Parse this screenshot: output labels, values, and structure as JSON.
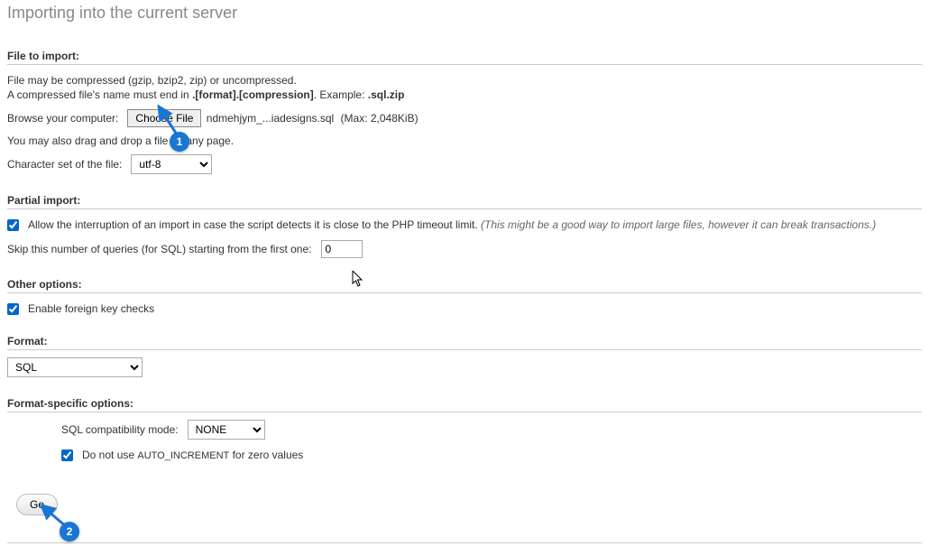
{
  "page_title": "Importing into the current server",
  "file_import": {
    "heading": "File to import:",
    "compress_note_1": "File may be compressed (gzip, bzip2, zip) or uncompressed.",
    "compress_note_2a": "A compressed file's name must end in ",
    "compress_note_2b": ".[format].[compression]",
    "compress_note_2c": ". Example: ",
    "compress_note_2d": ".sql.zip",
    "browse_label": "Browse your computer:",
    "choose_button": "Choose File",
    "selected_file": "ndmehjym_...iadesigns.sql",
    "max_size": "(Max: 2,048KiB)",
    "drag_note": "You may also drag and drop a file on any page.",
    "charset_label": "Character set of the file:",
    "charset_value": "utf-8"
  },
  "partial_import": {
    "heading": "Partial import:",
    "interrupt_label": "Allow the interruption of an import in case the script detects it is close to the PHP timeout limit.",
    "interrupt_note": "(This might be a good way to import large files, however it can break transactions.)",
    "skip_label": "Skip this number of queries (for SQL) starting from the first one:",
    "skip_value": "0"
  },
  "other_options": {
    "heading": "Other options:",
    "fk_label": "Enable foreign key checks"
  },
  "format": {
    "heading": "Format:",
    "value": "SQL"
  },
  "format_specific": {
    "heading": "Format-specific options:",
    "compat_label": "SQL compatibility mode:",
    "compat_value": "NONE",
    "noauto_prefix": "Do not use ",
    "noauto_code": "AUTO_INCREMENT",
    "noauto_suffix": " for zero values"
  },
  "go_button": "Go",
  "callouts": {
    "one": "1",
    "two": "2"
  }
}
